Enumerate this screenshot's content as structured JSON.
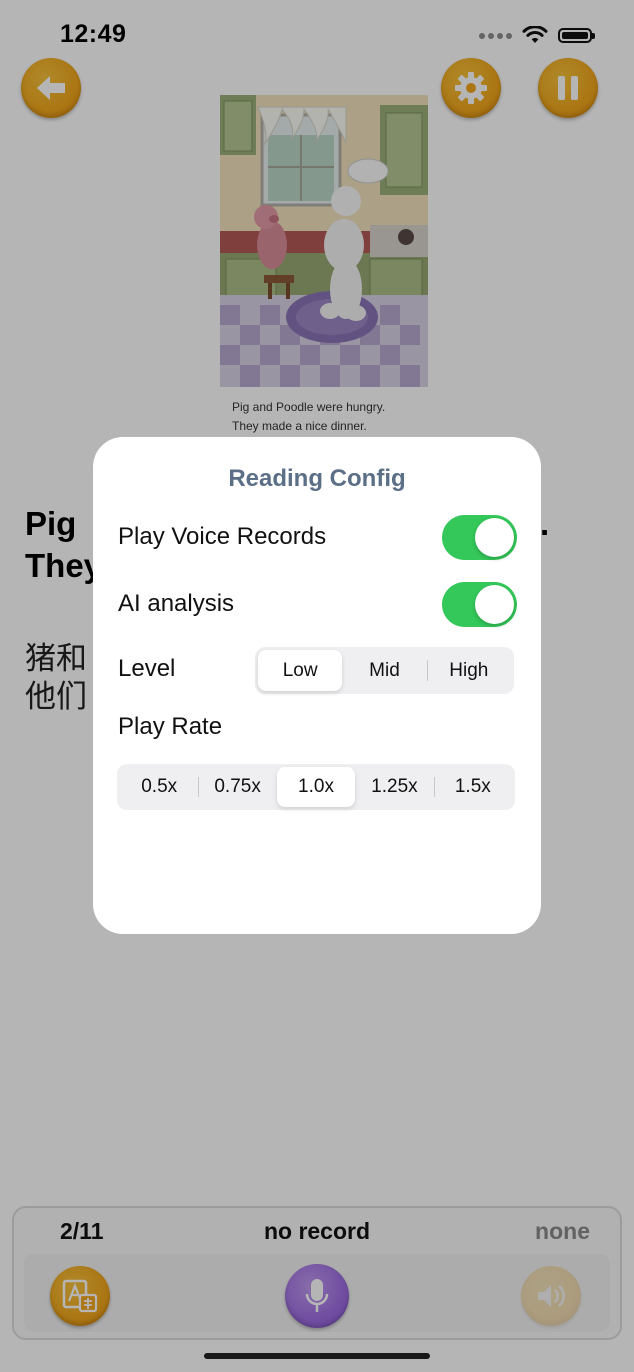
{
  "status_bar": {
    "time": "12:49"
  },
  "book": {
    "caption_line1": "Pig and Poodle were hungry.",
    "caption_line2": "They made a nice dinner.",
    "english_line1": "Pig",
    "english_line2": "They",
    "english_tail": ".",
    "chinese_line1": "猪和",
    "chinese_line2": "他们"
  },
  "bottom_bar": {
    "page_counter": "2/11",
    "record_status": "no record",
    "score": "none"
  },
  "modal": {
    "title": "Reading Config",
    "play_voice_records_label": "Play Voice Records",
    "play_voice_records_on": true,
    "ai_analysis_label": "AI analysis",
    "ai_analysis_on": true,
    "level_label": "Level",
    "level_options": [
      "Low",
      "Mid",
      "High"
    ],
    "level_selected": "Low",
    "play_rate_label": "Play Rate",
    "play_rate_options": [
      "0.5x",
      "0.75x",
      "1.0x",
      "1.25x",
      "1.5x"
    ],
    "play_rate_selected": "1.0x"
  },
  "colors": {
    "toggle_on": "#34c759",
    "modal_title": "#5b6f87",
    "orange_button": "#f1a71c",
    "mic_button": "#a271e4"
  },
  "icons": {
    "back": "arrow-left-icon",
    "settings": "gear-icon",
    "pause": "pause-icon",
    "translate": "translate-icon",
    "mic": "microphone-icon",
    "playback": "speaker-icon"
  }
}
